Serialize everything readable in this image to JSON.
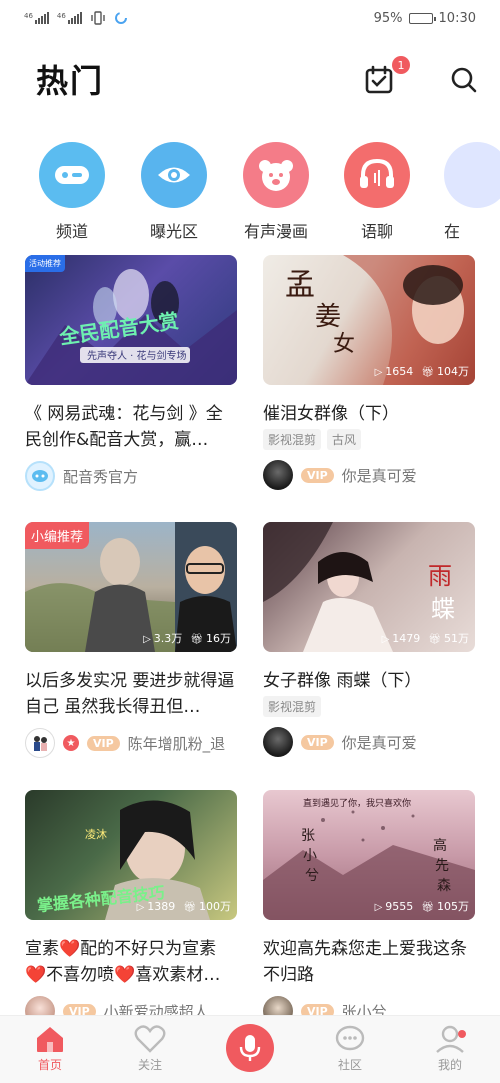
{
  "status": {
    "net1": "46",
    "net2": "46",
    "battery": "95%",
    "battery_level": 0.95,
    "time": "10:30"
  },
  "header": {
    "title": "热门",
    "notification_count": "1"
  },
  "categories": [
    {
      "label": "频道",
      "icon": "channel-icon",
      "color": "#5bbcf0"
    },
    {
      "label": "曝光区",
      "icon": "eye-icon",
      "color": "#58b4ee"
    },
    {
      "label": "有声漫画",
      "icon": "bear-icon",
      "color": "#f47c88"
    },
    {
      "label": "语聊",
      "icon": "headphones-icon",
      "color": "#f36d6d"
    },
    {
      "label": "在",
      "icon": "partial-icon",
      "color": "#9db7ff"
    }
  ],
  "cards": [
    {
      "title": "《 网易武魂：花与剑 》全民创作&配音大赏，赢…",
      "tag": "活动推荐",
      "author": "配音秀官方",
      "tags": [],
      "plays": "",
      "gifts": "",
      "vip": ""
    },
    {
      "title": "催泪女群像（下）",
      "tag": "",
      "author": "你是真可爱",
      "tags": [
        "影视混剪",
        "古风"
      ],
      "plays": "1654",
      "gifts": "104万",
      "vip": "VIP"
    },
    {
      "title": "以后多发实况 要进步就得逼自己 虽然我长得丑但…",
      "tag": "小编推荐",
      "author": "陈年增肌粉_退",
      "tags": [],
      "plays": "3.3万",
      "gifts": "16万",
      "vip": "VIP"
    },
    {
      "title": "女子群像 雨蝶（下）",
      "tag": "",
      "author": "你是真可爱",
      "tags": [
        "影视混剪"
      ],
      "plays": "1479",
      "gifts": "51万",
      "vip": "VIP"
    },
    {
      "title": "宣素❤️配的不好只为宣素❤️不喜勿喷❤️喜欢素材…",
      "tag": "",
      "author": "小新爱动感超人",
      "tags": [],
      "plays": "1389",
      "gifts": "100万",
      "vip": "VIP"
    },
    {
      "title": "欢迎高先森您走上爱我这条不归路",
      "tag": "",
      "author": "张小兮",
      "tags": [],
      "plays": "9555",
      "gifts": "105万",
      "vip": "VIP"
    }
  ],
  "nav": {
    "home": "首页",
    "follow": "关注",
    "community": "社区",
    "mine": "我的"
  }
}
